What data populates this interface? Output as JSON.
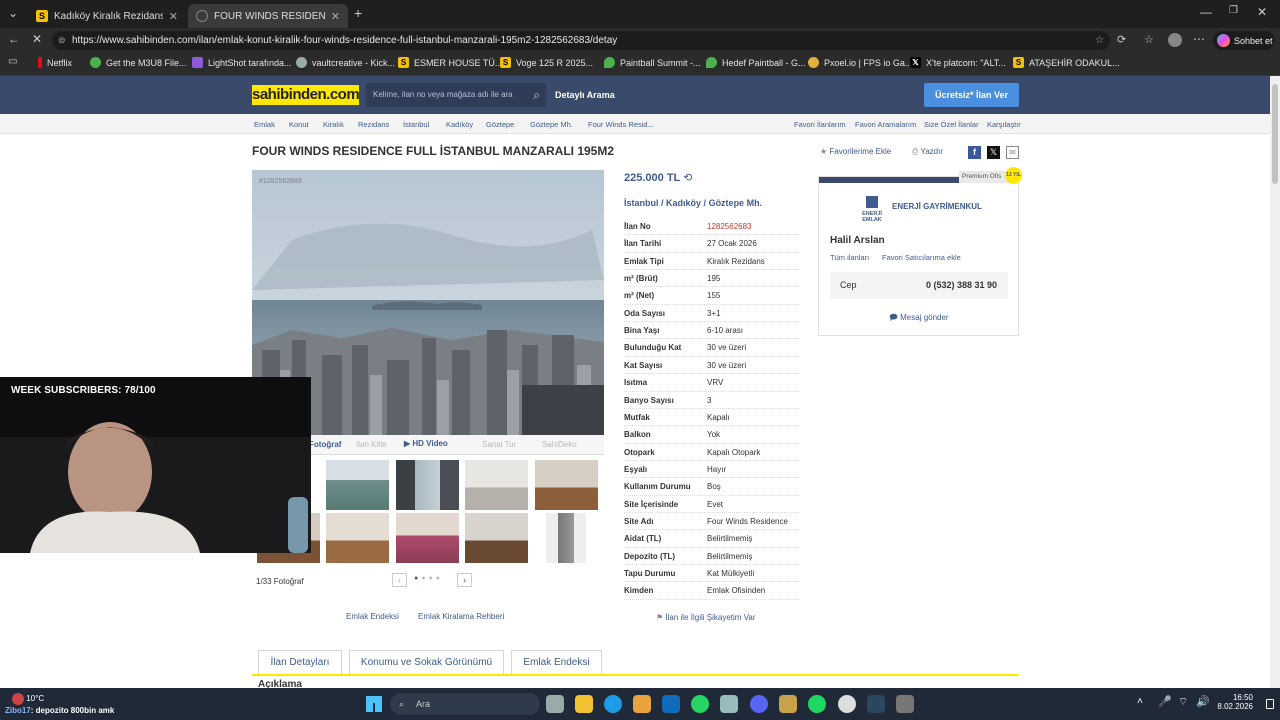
{
  "browser": {
    "tabs": [
      {
        "label": "Kadıköy Kiralık Rezidans Fiyatları s",
        "favicon": "S"
      },
      {
        "label": "FOUR WINDS RESIDENCE FULL İST",
        "favicon": ""
      }
    ],
    "url": "https://www.sahibinden.com/ilan/emlak-konut-kiralik-four-winds-residence-full-istanbul-manzarali-195m2-1282562683/detay",
    "chat_label": "Sohbet et",
    "bookmarks": [
      {
        "label": "Netflix",
        "icon": "netflix-icon"
      },
      {
        "label": "Get the M3U8 File...",
        "icon": "globe-icon"
      },
      {
        "label": "LightShot tarafında...",
        "icon": "feather-icon"
      },
      {
        "label": "vaultcreative - Kick...",
        "icon": "link-icon"
      },
      {
        "label": "ESMER HOUSE TÜ...",
        "icon": "S"
      },
      {
        "label": "Voge 125 R 2025...",
        "icon": "S"
      },
      {
        "label": "Paintball Summit -...",
        "icon": "pin-icon"
      },
      {
        "label": "Hedef Paintball - G...",
        "icon": "pin-icon"
      },
      {
        "label": "Pxoel.io | FPS io Ga...",
        "icon": "globe-icon"
      },
      {
        "label": "X'te platcom: \"ALT...",
        "icon": "x-icon"
      },
      {
        "label": "ATAŞEHİR ODAKUL...",
        "icon": "S"
      }
    ]
  },
  "site": {
    "logo": "sahibinden.com",
    "search_placeholder": "Kelime, ilan no veya mağaza adı ile ara",
    "detailed_search": "Detaylı Arama",
    "post_button": "Ücretsiz* İlan Ver",
    "breadcrumbs": [
      "Emlak",
      "Konut",
      "Kiralık",
      "Rezidans",
      "İstanbul",
      "Kadıköy",
      "Göztepe",
      "Göztepe Mh.",
      "Four Winds Resid..."
    ],
    "top_links": [
      "Favori İlanlarım",
      "Favori Aramalarım",
      "Size Özel İlanlar",
      "Karşılaştır"
    ]
  },
  "listing": {
    "title": "FOUR WINDS RESIDENCE FULL İSTANBUL MANZARALI 195M2",
    "add_favorites": "Favorilerime Ekle",
    "print": "Yazdır",
    "photo_id": "#1282562683",
    "media_tabs": [
      "Fotoğraf",
      "İlan Kitle",
      "HD Video",
      "Sanal Tur",
      "SahiDeko"
    ],
    "photo_counter": "1/33 Fotoğraf",
    "price": "225.000 TL",
    "location": [
      "İstanbul",
      "Kadıköy",
      "Göztepe Mh."
    ],
    "details": [
      {
        "k": "İlan No",
        "v": "1282562683"
      },
      {
        "k": "İlan Tarihi",
        "v": "27 Ocak 2026"
      },
      {
        "k": "Emlak Tipi",
        "v": "Kiralık Rezidans"
      },
      {
        "k": "m² (Brüt)",
        "v": "195"
      },
      {
        "k": "m² (Net)",
        "v": "155"
      },
      {
        "k": "Oda Sayısı",
        "v": "3+1"
      },
      {
        "k": "Bina Yaşı",
        "v": "6-10 arası"
      },
      {
        "k": "Bulunduğu Kat",
        "v": "30 ve üzeri"
      },
      {
        "k": "Kat Sayısı",
        "v": "30 ve üzeri"
      },
      {
        "k": "Isıtma",
        "v": "VRV"
      },
      {
        "k": "Banyo Sayısı",
        "v": "3"
      },
      {
        "k": "Mutfak",
        "v": "Kapalı"
      },
      {
        "k": "Balkon",
        "v": "Yok"
      },
      {
        "k": "Otopark",
        "v": "Kapalı Otopark"
      },
      {
        "k": "Eşyalı",
        "v": "Hayır"
      },
      {
        "k": "Kullanım Durumu",
        "v": "Boş"
      },
      {
        "k": "Site İçerisinde",
        "v": "Evet"
      },
      {
        "k": "Site Adı",
        "v": "Four Winds Residence"
      },
      {
        "k": "Aidat (TL)",
        "v": "Belirtilmemiş"
      },
      {
        "k": "Depozito (TL)",
        "v": "Belirtilmemiş"
      },
      {
        "k": "Tapu Durumu",
        "v": "Kat Mülkiyetli"
      },
      {
        "k": "Kimden",
        "v": "Emlak Ofisinden"
      }
    ],
    "complaint": "İlan ile İlgili Şikayetim Var",
    "bottom_links": [
      "Emlak Endeksi",
      "Emlak Kiralama Rehberi"
    ],
    "section_tabs": [
      "İlan Detayları",
      "Konumu ve Sokak Görünümü",
      "Emlak Endeksi"
    ],
    "next_heading": "Açıklama"
  },
  "seller": {
    "badge": "Premium Ofis",
    "years": "12 YIL",
    "agency": "ENERJİ GAYRİMENKUL",
    "logo_text": "ENERJİ EMLAK",
    "name": "Halil Arslan",
    "all_listings": "Tüm ilanları",
    "fav_seller": "Favori Satıcılarıma ekle",
    "phone_label": "Cep",
    "phone": "0 (532) 388 31 90",
    "message": "Mesaj gönder"
  },
  "overlay": {
    "subs": "WEEK SUBSCRIBERS: 78/100",
    "chat_user": "Zibo17",
    "chat_msg": ": depozito 800bin amk"
  },
  "taskbar": {
    "weather": "10°C",
    "search": "Ara",
    "time": "16:50",
    "date": "8.02.2026"
  },
  "colors": {
    "brand_yellow": "#ffe800",
    "header": "#3a4a6b",
    "link": "#3e5c90",
    "price_red": "#c0392b"
  }
}
